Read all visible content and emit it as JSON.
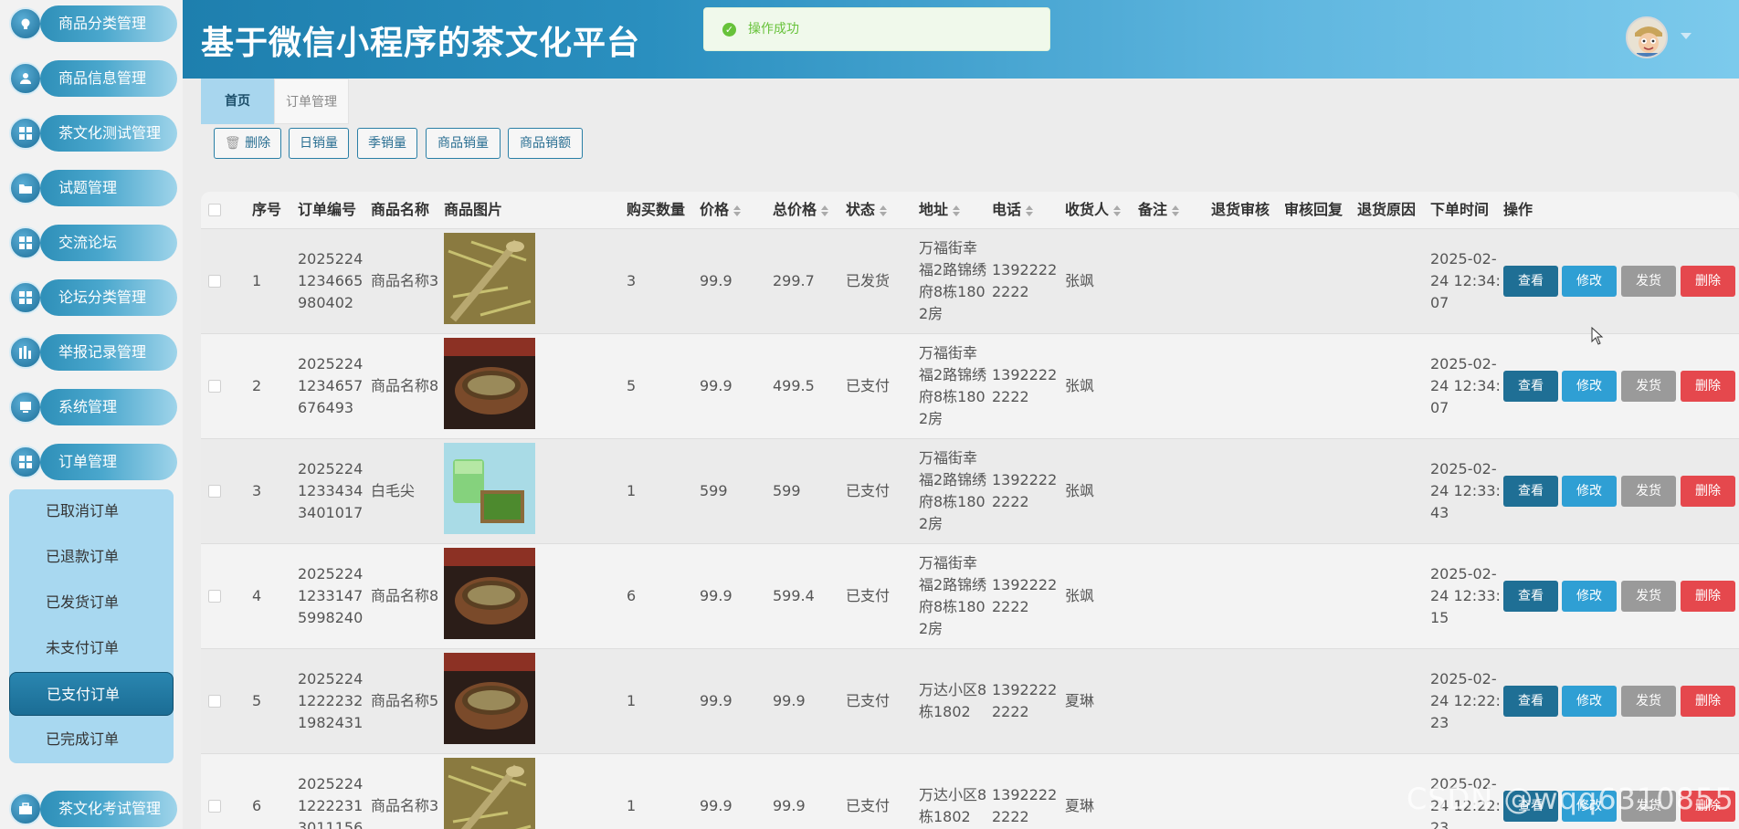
{
  "app": {
    "title": "基于微信小程序的茶文化平台",
    "toast": "操作成功"
  },
  "sidebar": {
    "items": [
      {
        "label": "商品分类管理",
        "icon": "bulb-icon"
      },
      {
        "label": "商品信息管理",
        "icon": "user-icon"
      },
      {
        "label": "茶文化测试管理",
        "icon": "grid-icon"
      },
      {
        "label": "试题管理",
        "icon": "folder-icon"
      },
      {
        "label": "交流论坛",
        "icon": "grid-icon"
      },
      {
        "label": "论坛分类管理",
        "icon": "grid-icon"
      },
      {
        "label": "举报记录管理",
        "icon": "chart-icon"
      },
      {
        "label": "系统管理",
        "icon": "monitor-icon"
      },
      {
        "label": "订单管理",
        "icon": "grid-icon"
      },
      {
        "label": "茶文化考试管理",
        "icon": "briefcase-icon"
      }
    ],
    "submenu": [
      "已取消订单",
      "已退款订单",
      "已发货订单",
      "未支付订单",
      "已支付订单",
      "已完成订单"
    ],
    "active_submenu": "已支付订单"
  },
  "tabs": [
    {
      "label": "首页"
    },
    {
      "label": "订单管理"
    }
  ],
  "toolbar": {
    "delete": "删除",
    "daily": "日销量",
    "quarter": "季销量",
    "product_sales": "商品销量",
    "product_amount": "商品销额"
  },
  "table": {
    "headers": {
      "index": "序号",
      "order_no": "订单编号",
      "name": "商品名称",
      "image": "商品图片",
      "qty": "购买数量",
      "price": "价格",
      "total": "总价格",
      "status": "状态",
      "address": "地址",
      "phone": "电话",
      "receiver": "收货人",
      "remark": "备注",
      "return_review": "退货审核",
      "review_reply": "审核回复",
      "return_reason": "退货原因",
      "order_time": "下单时间",
      "actions": "操作"
    },
    "actions": {
      "view": "查看",
      "edit": "修改",
      "ship": "发货",
      "delete": "删除"
    },
    "rows": [
      {
        "index": "1",
        "order_no": [
          "2025224",
          "1234665",
          "980402"
        ],
        "name": "商品名称3",
        "qty": "3",
        "price": "99.9",
        "total": "299.7",
        "status": "已发货",
        "address": [
          "万福街幸",
          "福2路锦绣",
          "府8栋180",
          "2房"
        ],
        "phone": [
          "1392222",
          "2222"
        ],
        "receiver": "张飒",
        "time": [
          "2025-02-",
          "24 12:34:",
          "07"
        ],
        "img": "tea-leaves"
      },
      {
        "index": "2",
        "order_no": [
          "2025224",
          "1234657",
          "676493"
        ],
        "name": "商品名称8",
        "qty": "5",
        "price": "99.9",
        "total": "499.5",
        "status": "已支付",
        "address": [
          "万福街幸",
          "福2路锦绣",
          "府8栋180",
          "2房"
        ],
        "phone": [
          "1392222",
          "2222"
        ],
        "receiver": "张飒",
        "time": [
          "2025-02-",
          "24 12:34:",
          "07"
        ],
        "img": "tea-cup"
      },
      {
        "index": "3",
        "order_no": [
          "2025224",
          "1233434",
          "3401017"
        ],
        "name": "白毛尖",
        "qty": "1",
        "price": "599",
        "total": "599",
        "status": "已支付",
        "address": [
          "万福街幸",
          "福2路锦绣",
          "府8栋180",
          "2房"
        ],
        "phone": [
          "1392222",
          "2222"
        ],
        "receiver": "张飒",
        "time": [
          "2025-02-",
          "24 12:33:",
          "43"
        ],
        "img": "green-tea"
      },
      {
        "index": "4",
        "order_no": [
          "2025224",
          "1233147",
          "5998240"
        ],
        "name": "商品名称8",
        "qty": "6",
        "price": "99.9",
        "total": "599.4",
        "status": "已支付",
        "address": [
          "万福街幸",
          "福2路锦绣",
          "府8栋180",
          "2房"
        ],
        "phone": [
          "1392222",
          "2222"
        ],
        "receiver": "张飒",
        "time": [
          "2025-02-",
          "24 12:33:",
          "15"
        ],
        "img": "tea-cup"
      },
      {
        "index": "5",
        "order_no": [
          "2025224",
          "1222232",
          "1982431"
        ],
        "name": "商品名称5",
        "qty": "1",
        "price": "99.9",
        "total": "99.9",
        "status": "已支付",
        "address": [
          "万达小区8",
          "栋1802"
        ],
        "phone": [
          "1392222",
          "2222"
        ],
        "receiver": "夏琳",
        "time": [
          "2025-02-",
          "24 12:22:",
          "23"
        ],
        "img": "tea-cup"
      },
      {
        "index": "6",
        "order_no": [
          "2025224",
          "1222231",
          "3011156"
        ],
        "name": "商品名称3",
        "qty": "1",
        "price": "99.9",
        "total": "99.9",
        "status": "已支付",
        "address": [
          "万达小区8",
          "栋1802"
        ],
        "phone": [
          "1392222",
          "2222"
        ],
        "receiver": "夏琳",
        "time": [
          "2025-02-",
          "24 12:22:",
          "23"
        ],
        "img": "tea-leaves"
      }
    ]
  },
  "watermark": "CSDN @wqq6310855",
  "colors": {
    "accent": "#2a8fbf",
    "view": "#1f6f95",
    "edit": "#2f9fd4",
    "ship": "#9a9a9a",
    "delete": "#e5484d",
    "success": "#67c23a"
  }
}
